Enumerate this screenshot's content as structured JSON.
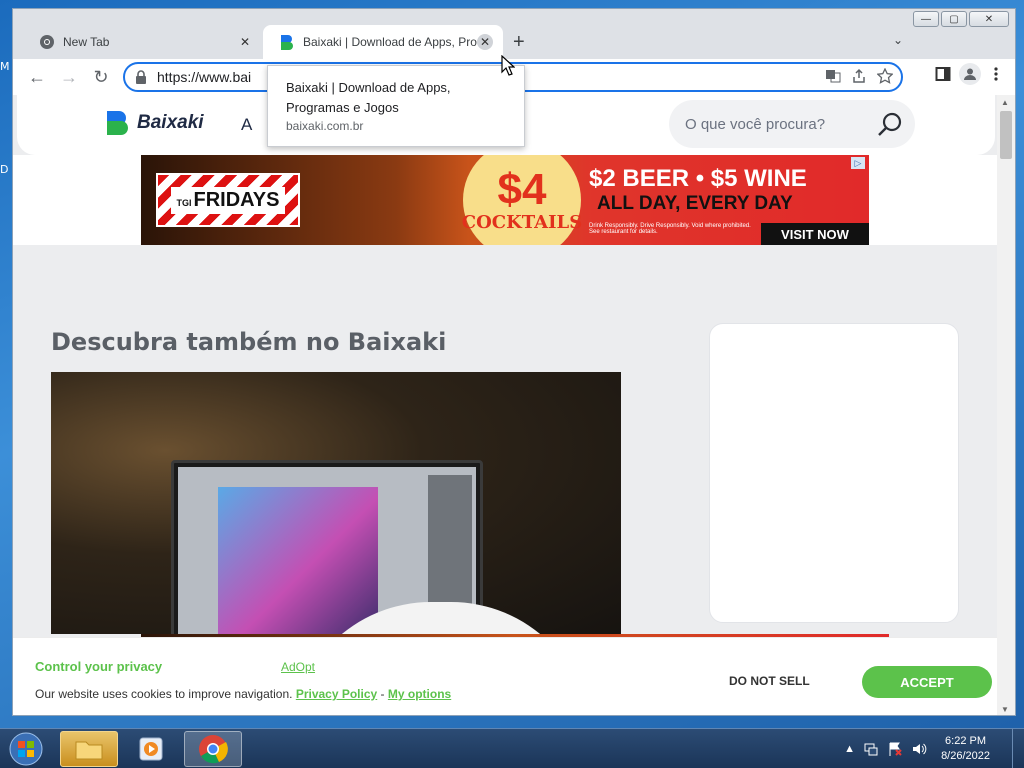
{
  "desktop": {
    "chars": [
      "M",
      "D"
    ]
  },
  "window": {
    "minimize": "—",
    "maximize": "▢",
    "close": "✕"
  },
  "tabs": [
    {
      "title": "New Tab",
      "close": "✕"
    },
    {
      "title": "Baixaki | Download de Apps, Prog",
      "close": "✕"
    }
  ],
  "new_tab": "+",
  "tab_menu": "⌄",
  "toolbar": {
    "back": "←",
    "forward": "→",
    "reload": "↻"
  },
  "address": {
    "url": "https://www.bai"
  },
  "tooltip": {
    "title": "Baixaki | Download de Apps, Programas e Jogos",
    "url": "baixaki.com.br"
  },
  "site": {
    "logo": "Baixaki",
    "nav_letter": "A",
    "search_placeholder": "O que você procura?"
  },
  "ad": {
    "brand_tgi": "TGI",
    "brand": "FRIDAYS",
    "price": "$4",
    "cocktails": "COCKTAILS",
    "line1": "$2 BEER • $5 WINE",
    "line2": "ALL DAY, EVERY DAY",
    "fine": "Drink Responsibly. Drive Responsibly.  Void where prohibited. See restaurant for details.",
    "cta": "VISIT NOW"
  },
  "section": {
    "title": "Descubra também no Baixaki"
  },
  "privacy": {
    "title": "Control your privacy",
    "adopt": "AdOpt",
    "text": "Our website uses cookies to improve navigation.",
    "policy": "Privacy Policy",
    "sep": "-",
    "options": "My options",
    "do_not_sell": "DO NOT SELL",
    "accept": "ACCEPT"
  },
  "taskbar": {
    "time": "6:22 PM",
    "date": "8/26/2022"
  },
  "colors": {
    "accent_green": "#5cc24b",
    "chrome_blue": "#1a73e8"
  }
}
